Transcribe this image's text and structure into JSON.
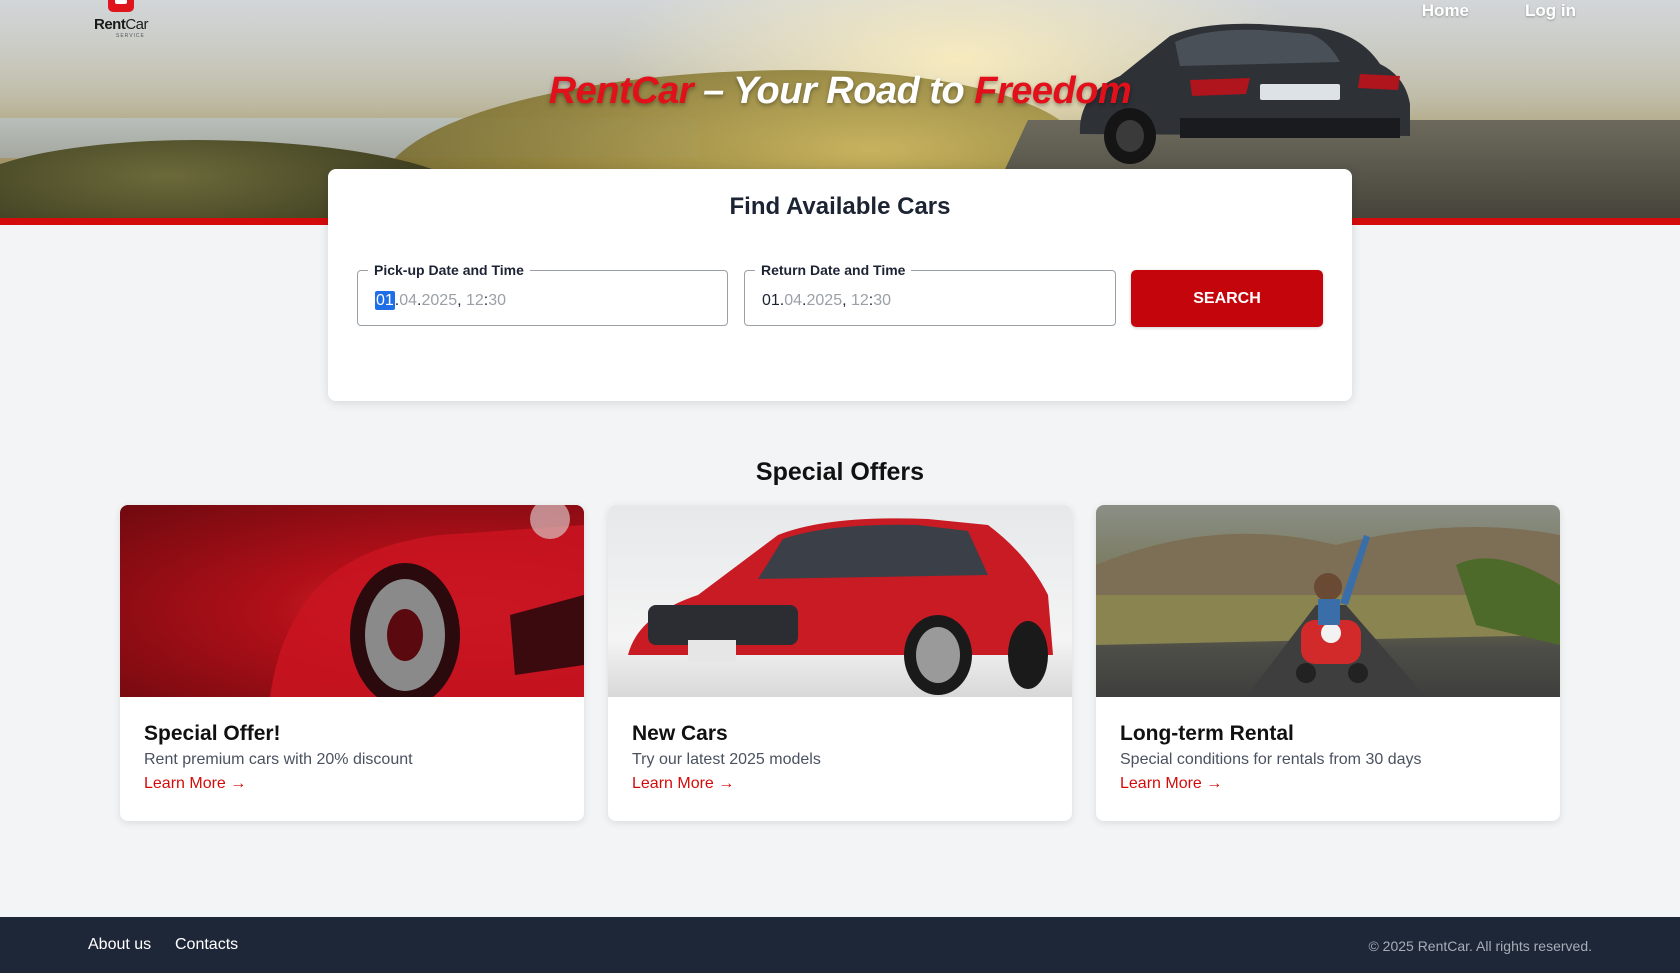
{
  "header": {
    "logo_text_bold": "Rent",
    "logo_text_regular": "Car",
    "logo_sub": "SERVICE",
    "nav": [
      "Home",
      "Log in"
    ]
  },
  "hero": {
    "title_part1": "RentCar",
    "title_part2": " – Your Road to ",
    "title_part3": "Freedom"
  },
  "search": {
    "title": "Find Available Cars",
    "pickup_label": "Pick-up Date and Time",
    "pickup_day": "01",
    "pickup_month": "04",
    "pickup_year": "2025",
    "pickup_hour": "12",
    "pickup_min": "30",
    "return_label": "Return Date and Time",
    "return_day": "01",
    "return_month": "04",
    "return_year": "2025",
    "return_hour": "12",
    "return_min": "30",
    "button_label": "SEARCH"
  },
  "offers": {
    "title": "Special Offers",
    "cards": [
      {
        "title": "Special Offer!",
        "desc": "Rent premium cars with 20% discount",
        "link": "Learn More →"
      },
      {
        "title": "New Cars",
        "desc": "Try our latest 2025 models",
        "link": "Learn More →"
      },
      {
        "title": "Long-term Rental",
        "desc": "Special conditions for rentals from 30 days",
        "link": "Learn More →"
      }
    ]
  },
  "footer": {
    "links": [
      "About us",
      "Contacts"
    ],
    "copyright": "© 2025 RentCar. All rights reserved."
  },
  "colors": {
    "accent": "#d40b0b",
    "button": "#c4050c",
    "footer_bg": "#1e2738",
    "page_bg": "#f2f4f6"
  }
}
